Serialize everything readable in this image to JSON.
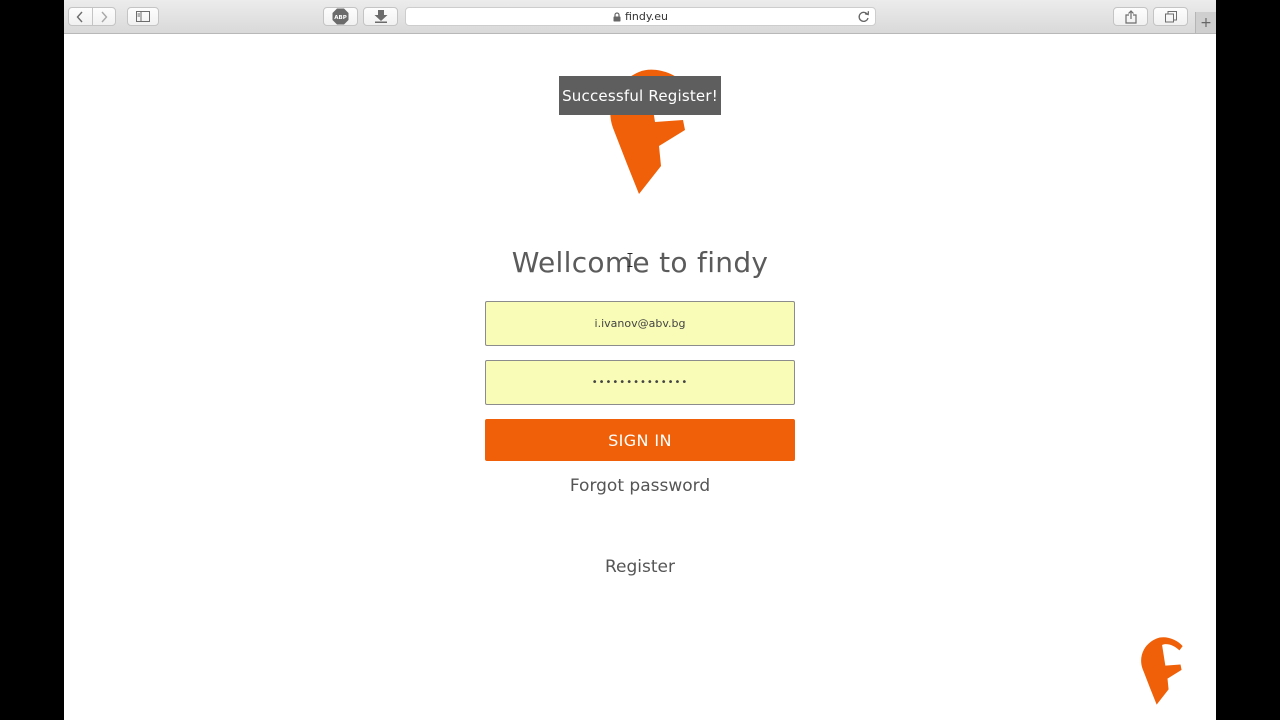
{
  "browser": {
    "address": "findy.eu",
    "abp_label": "ABP",
    "new_tab_symbol": "+"
  },
  "toast": {
    "message": "Successful Register!"
  },
  "login": {
    "title": "Wellcome to findy",
    "email_value": "i.ivanov@abv.bg",
    "password_value": "••••••••••••••",
    "signin_label": "SIGN IN",
    "forgot_label": "Forgot password",
    "register_label": "Register"
  },
  "colors": {
    "brand_orange": "#ef6008",
    "field_bg": "#f8fcb6",
    "toast_bg": "#5e5e5e"
  },
  "icons": [
    "back-icon",
    "forward-icon",
    "sidebar-icon",
    "download-icon",
    "lock-icon",
    "reload-icon",
    "share-icon",
    "tabs-icon",
    "findy-logo",
    "text-cursor-icon"
  ]
}
